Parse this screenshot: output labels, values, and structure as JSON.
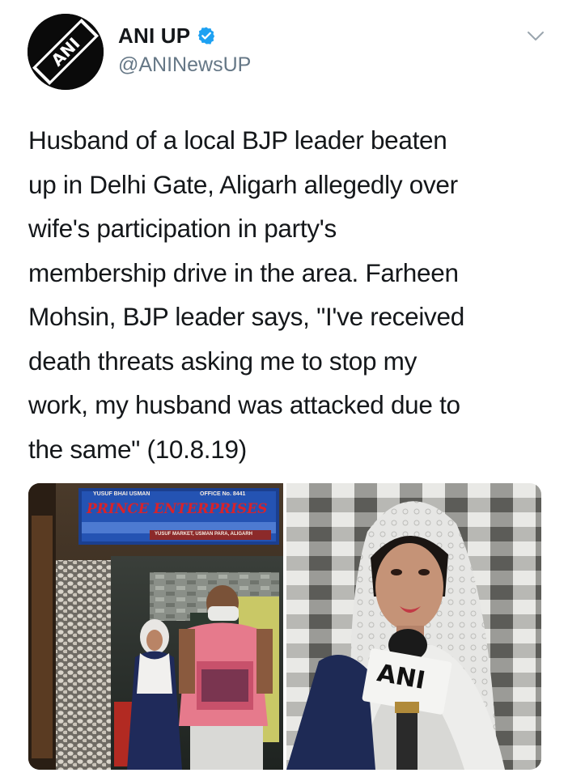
{
  "account": {
    "display_name": "ANI UP",
    "handle": "@ANINewsUP",
    "avatar_text": "ANI",
    "verified": true
  },
  "tweet": {
    "text": "Husband of a local BJP leader beaten\nup in Delhi Gate, Aligarh allegedly over\nwife's participation in party's\nmembership drive in the area. Farheen\nMohsin, BJP leader says, \"I've received\ndeath threats asking me to stop my\nwork, my husband was attacked due to\nthe same\" (10.8.19)"
  },
  "media": {
    "photo1": {
      "sign_main": "PRINCE ENTERPRISES",
      "sign_top_left": "YUSUF BHAI USMAN",
      "sign_office": "OFFICE No. 8441",
      "sign_address": "YUSUF MARKET, USMAN PARA, ALIGARH"
    },
    "photo2": {
      "mic_label": "ANI"
    }
  },
  "colors": {
    "name": "#14171a",
    "handle": "#657786",
    "verified_badge": "#1da1f2",
    "sign_text": "#d8232a"
  }
}
